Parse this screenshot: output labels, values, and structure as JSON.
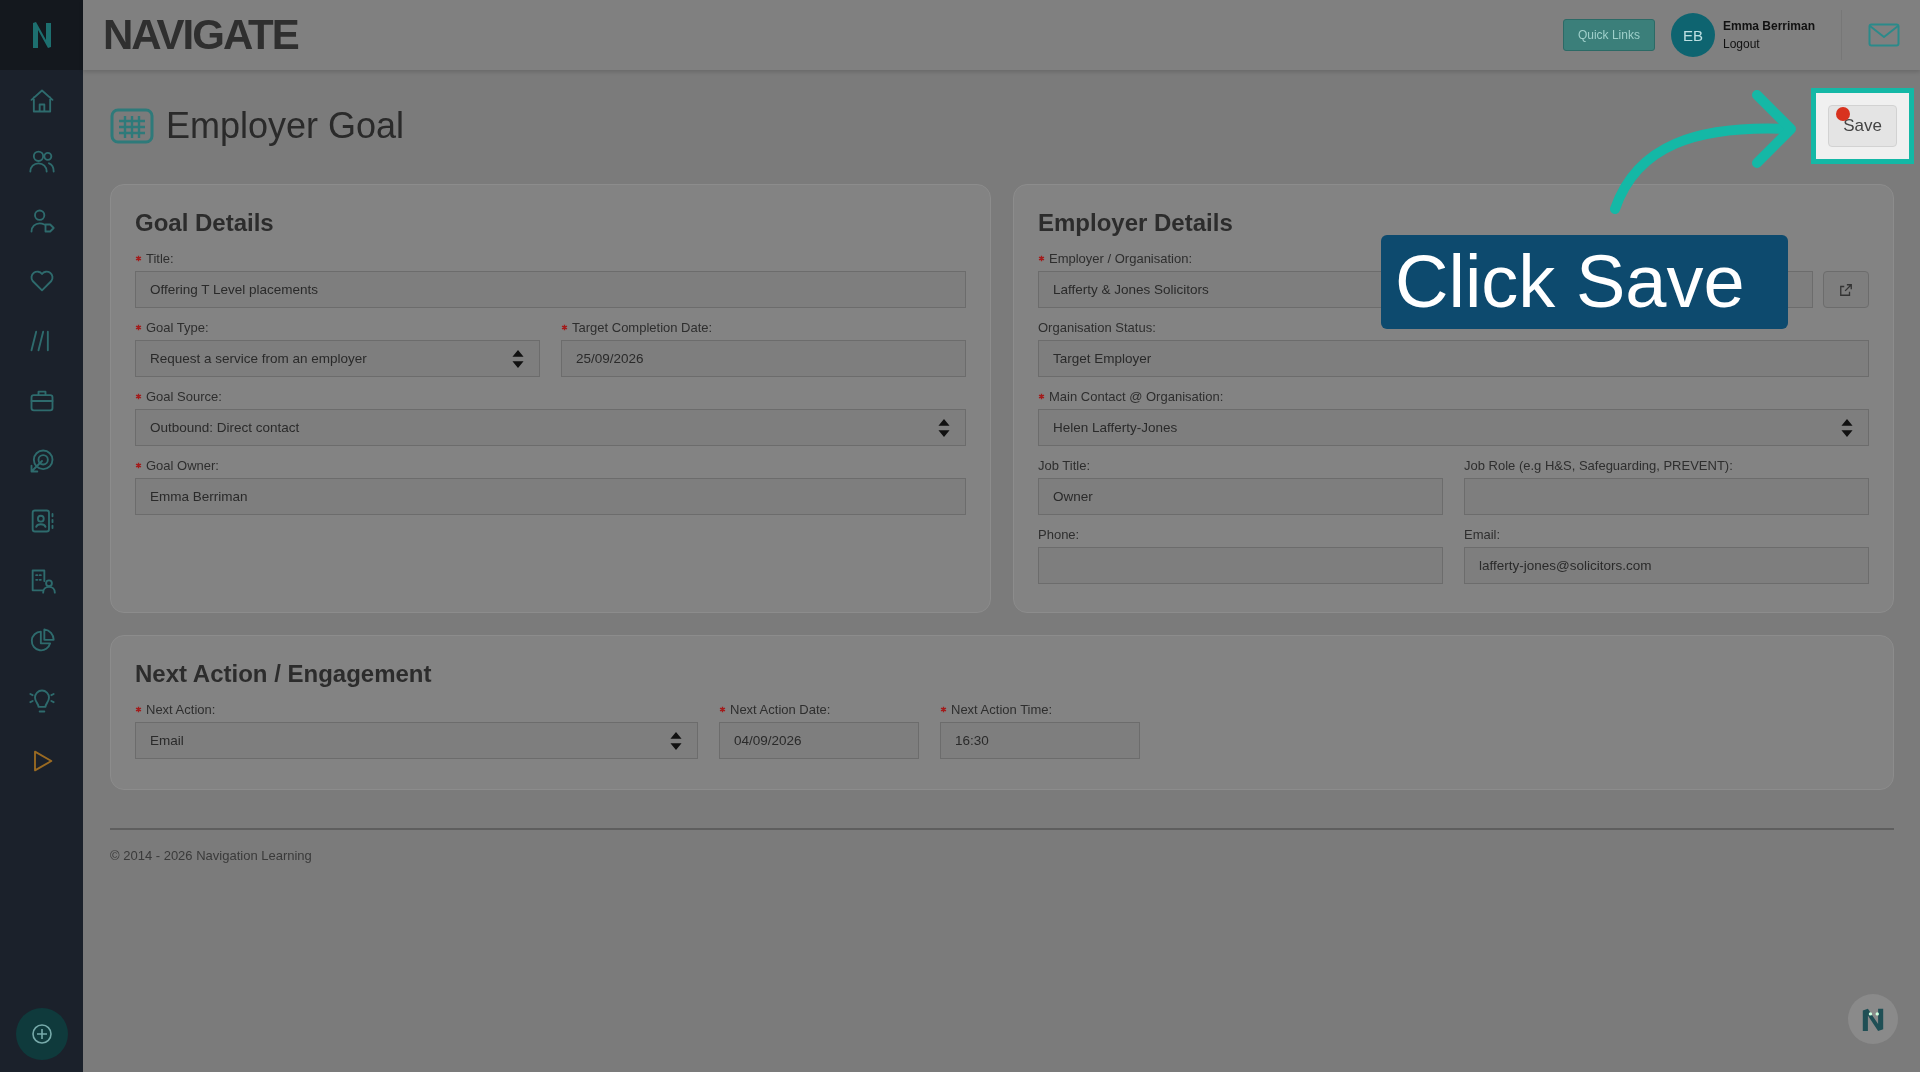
{
  "header": {
    "logo": "NAVIGATE",
    "quick_links": "Quick Links",
    "user": {
      "initials": "EB",
      "name": "Emma Berriman",
      "logout": "Logout"
    }
  },
  "page": {
    "title": "Employer Goal",
    "save_button": {
      "label": "Save",
      "highlighted": true,
      "notification_dot": true
    }
  },
  "tutorial": {
    "callout": "Click Save"
  },
  "cards": [
    {
      "title": "Goal Details",
      "kind": "form",
      "rows": [
        {
          "fields": [
            {
              "label": "Title:",
              "required": true,
              "kind": "text",
              "value": "Offering T Level placements"
            }
          ]
        },
        {
          "fields": [
            {
              "label": "Goal Type:",
              "required": true,
              "kind": "select",
              "value": "Request a service from an employer"
            },
            {
              "label": "Target Completion Date:",
              "required": true,
              "kind": "text",
              "value": "25/09/2026"
            }
          ]
        },
        {
          "fields": [
            {
              "label": "Goal Source:",
              "required": true,
              "kind": "select",
              "value": "Outbound: Direct contact"
            }
          ]
        },
        {
          "fields": [
            {
              "label": "Goal Owner:",
              "required": true,
              "kind": "text",
              "value": "Emma Berriman"
            }
          ]
        }
      ]
    },
    {
      "title": "Employer Details",
      "kind": "form",
      "rows": [
        {
          "fields": [
            {
              "label": "Employer / Organisation:",
              "required": true,
              "kind": "link",
              "value": "Lafferty & Jones Solicitors"
            }
          ]
        },
        {
          "fields": [
            {
              "label": "Organisation Status:",
              "required": false,
              "kind": "text",
              "value": "Target Employer"
            }
          ]
        },
        {
          "fields": [
            {
              "label": "Main Contact @ Organisation:",
              "required": true,
              "kind": "select",
              "value": "Helen Lafferty-Jones"
            }
          ]
        },
        {
          "fields": [
            {
              "label": "Job Title:",
              "required": false,
              "kind": "text",
              "value": "Owner"
            },
            {
              "label": "Job Role (e.g H&S, Safeguarding, PREVENT):",
              "required": false,
              "kind": "text"
            }
          ]
        },
        {
          "fields": [
            {
              "label": "Phone:",
              "required": false,
              "kind": "text"
            },
            {
              "label": "Email:",
              "required": false,
              "kind": "text",
              "value": "lafferty-jones@solicitors.com"
            }
          ]
        }
      ]
    },
    {
      "title": "Next Action / Engagement",
      "kind": "inline",
      "rows": [
        {
          "fields": [
            {
              "label": "Next Action:",
              "required": true,
              "kind": "select",
              "value": "Email"
            },
            {
              "label": "Next Action Date:",
              "required": true,
              "kind": "text",
              "value": "04/09/2026"
            },
            {
              "label": "Next Action Time:",
              "required": true,
              "kind": "text",
              "value": "16:30"
            }
          ]
        }
      ]
    }
  ],
  "footer": "© 2014 - 2026 Navigation Learning"
}
